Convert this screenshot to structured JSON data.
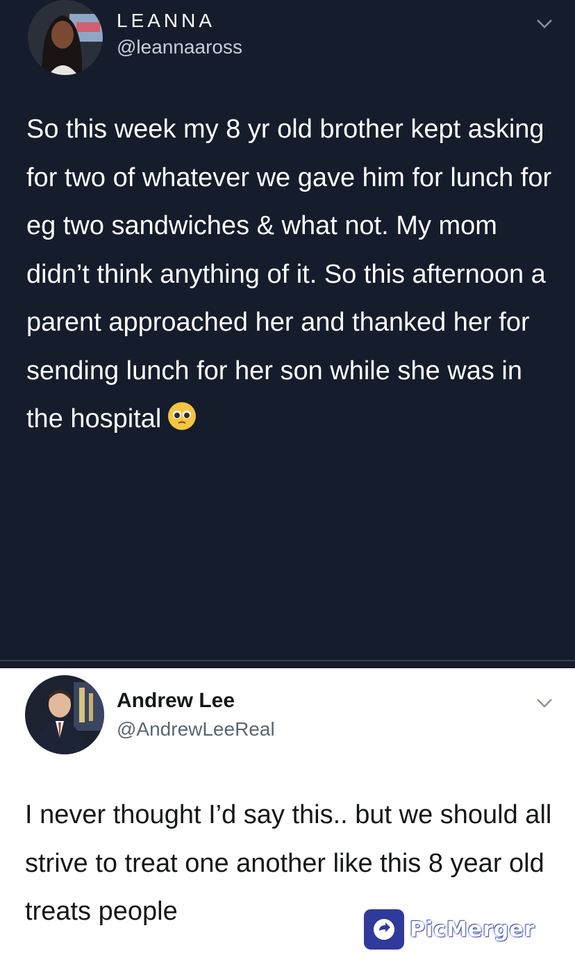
{
  "tweet1": {
    "name": "LEANNA",
    "handle": "@leannaaross",
    "text": "So this week my 8 yr old brother kept asking for two of whatever we gave him for lunch for eg two sandwiches & what not. My mom didn’t think anything of it. So this afternoon a parent approached her and thanked her for sending lunch for her son while she was in the hospital",
    "emoji_icon": "pleading-face-icon"
  },
  "tweet2": {
    "name": "Andrew Lee",
    "handle": "@AndrewLeeReal",
    "text": "I never thought I’d say this.. but we should all strive to treat one another like this 8 year old treats people"
  },
  "watermark": {
    "label": "PicMerger"
  },
  "colors": {
    "dark_bg": "#151c2b",
    "light_bg": "#ffffff",
    "handle_dark": "#c9ced8",
    "handle_light": "#5b6670"
  }
}
